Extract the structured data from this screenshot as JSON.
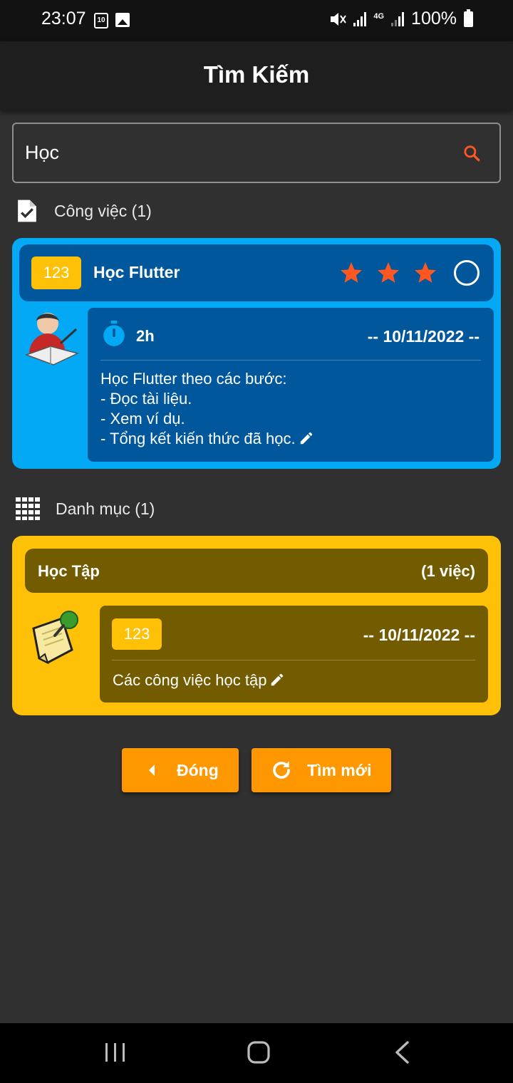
{
  "status_bar": {
    "time": "23:07",
    "calendar_day": "10",
    "network_type": "4G",
    "battery_percent": "100%"
  },
  "appbar": {
    "title": "Tìm Kiếm"
  },
  "search": {
    "value": "Học"
  },
  "tasks_section": {
    "label": "Công việc (1)",
    "items": [
      {
        "badge": "123",
        "title": "Học Flutter",
        "priority_stars": 3,
        "duration": "2h",
        "date": "-- 10/11/2022 --",
        "description": "Học Flutter theo các bước:\n- Đọc tài liệu.\n- Xem ví dụ.\n- Tổng kết kiến thức đã học."
      }
    ]
  },
  "categories_section": {
    "label": "Danh mục (1)",
    "items": [
      {
        "title": "Học Tập",
        "count": "(1 việc)",
        "badge": "123",
        "date": "-- 10/11/2022 --",
        "description": "Các công việc học tập"
      }
    ]
  },
  "buttons": {
    "close": "Đóng",
    "new_search": "Tìm mới"
  },
  "colors": {
    "accent_orange": "#ff9800",
    "task_card": "#03a9f4",
    "task_card_inner": "#01579b",
    "category_card": "#ffc107",
    "category_card_inner": "#735c00",
    "star": "#ff5722"
  }
}
